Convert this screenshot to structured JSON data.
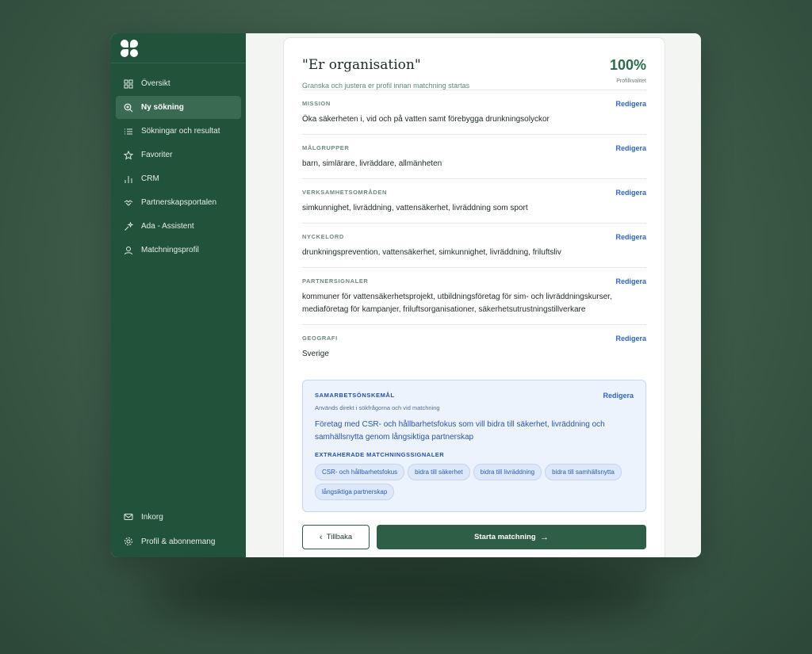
{
  "sidebar": {
    "items": [
      {
        "label": "Översikt",
        "icon": "grid-icon"
      },
      {
        "label": "Ny sökning",
        "icon": "search-icon",
        "active": true
      },
      {
        "label": "Sökningar och resultat",
        "icon": "list-icon"
      },
      {
        "label": "Favoriter",
        "icon": "star-icon"
      },
      {
        "label": "CRM",
        "icon": "bar-chart-icon"
      },
      {
        "label": "Partnerskapsportalen",
        "icon": "handshake-icon"
      },
      {
        "label": "Ada - Assistent",
        "icon": "sparkle-icon"
      },
      {
        "label": "Matchningsprofil",
        "icon": "user-icon"
      }
    ],
    "bottom": [
      {
        "label": "Inkorg",
        "icon": "mail-icon"
      },
      {
        "label": "Profil & abonnemang",
        "icon": "gear-icon"
      }
    ]
  },
  "profile": {
    "title": "\"Er organisation\"",
    "subtitle": "Granska och justera er profil innan matchning startas",
    "quality_value": "100%",
    "quality_label": "Profilkvalitet",
    "edit_label": "Redigera",
    "sections": [
      {
        "label": "MISSION",
        "value": "Öka säkerheten i, vid och på vatten samt förebygga drunkningsolyckor"
      },
      {
        "label": "MÅLGRUPPER",
        "value": "barn, simlärare, livräddare, allmänheten"
      },
      {
        "label": "VERKSAMHETSOMRÅDEN",
        "value": "simkunnighet, livräddning, vattensäkerhet, livräddning som sport"
      },
      {
        "label": "NYCKELORD",
        "value": "drunkningsprevention, vattensäkerhet, simkunnighet, livräddning, friluftsliv"
      },
      {
        "label": "PARTNERSIGNALER",
        "value": "kommuner för vattensäkerhetsprojekt, utbildningsföretag för sim- och livräddningskurser, mediaföretag för kampanjer, friluftsorganisationer, säkerhetsutrustningstillverkare"
      },
      {
        "label": "GEOGRAFI",
        "value": "Sverige"
      }
    ],
    "goal": {
      "label": "SAMARBETSÖNSKEMÅL",
      "hint": "Används direkt i sökfrågorna och vid matchning",
      "text": "Företag med CSR- och hållbarhetsfokus som vill bidra till säkerhet, livräddning och samhällsnytta genom långsiktiga partnerskap",
      "signals_label": "EXTRAHERADE MATCHNINGSSIGNALER",
      "chips": [
        "CSR- och hållbarhetsfokus",
        "bidra till säkerhet",
        "bidra till livräddning",
        "bidra till samhällsnytta",
        "långsiktiga partnerskap"
      ]
    },
    "back_label": "Tillbaka",
    "start_label": "Starta matchning"
  }
}
